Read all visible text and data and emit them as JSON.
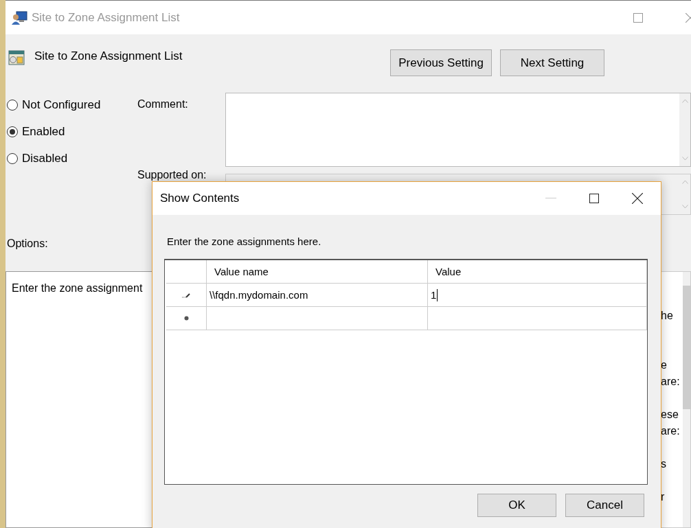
{
  "window": {
    "title": "Site to Zone Assignment List"
  },
  "header": {
    "title": "Site to Zone Assignment List",
    "buttons": [
      "Previous Setting",
      "Next Setting"
    ]
  },
  "states": [
    {
      "label": "Not Configured",
      "selected": false
    },
    {
      "label": "Enabled",
      "selected": true
    },
    {
      "label": "Disabled",
      "selected": false
    }
  ],
  "comment": {
    "label": "Comment:"
  },
  "supported_on": {
    "label": "Supported on:"
  },
  "options": {
    "label": "Options:",
    "text": "Enter the zone assignment"
  },
  "help": {
    "fragments": [
      [
        "he"
      ],
      [
        "e",
        "are:"
      ],
      [
        "ese",
        "are:"
      ],
      [
        "s"
      ],
      [
        "r"
      ]
    ]
  },
  "dialog": {
    "title": "Show Contents",
    "prompt": "Enter the zone assignments here.",
    "table": {
      "columns": [
        "Value name",
        "Value"
      ],
      "rows": [
        {
          "kind": "editing",
          "cells": [
            "\\\\fqdn.mydomain.com",
            "1"
          ]
        },
        {
          "kind": "new"
        }
      ]
    },
    "buttons": [
      "OK",
      "Cancel"
    ]
  }
}
